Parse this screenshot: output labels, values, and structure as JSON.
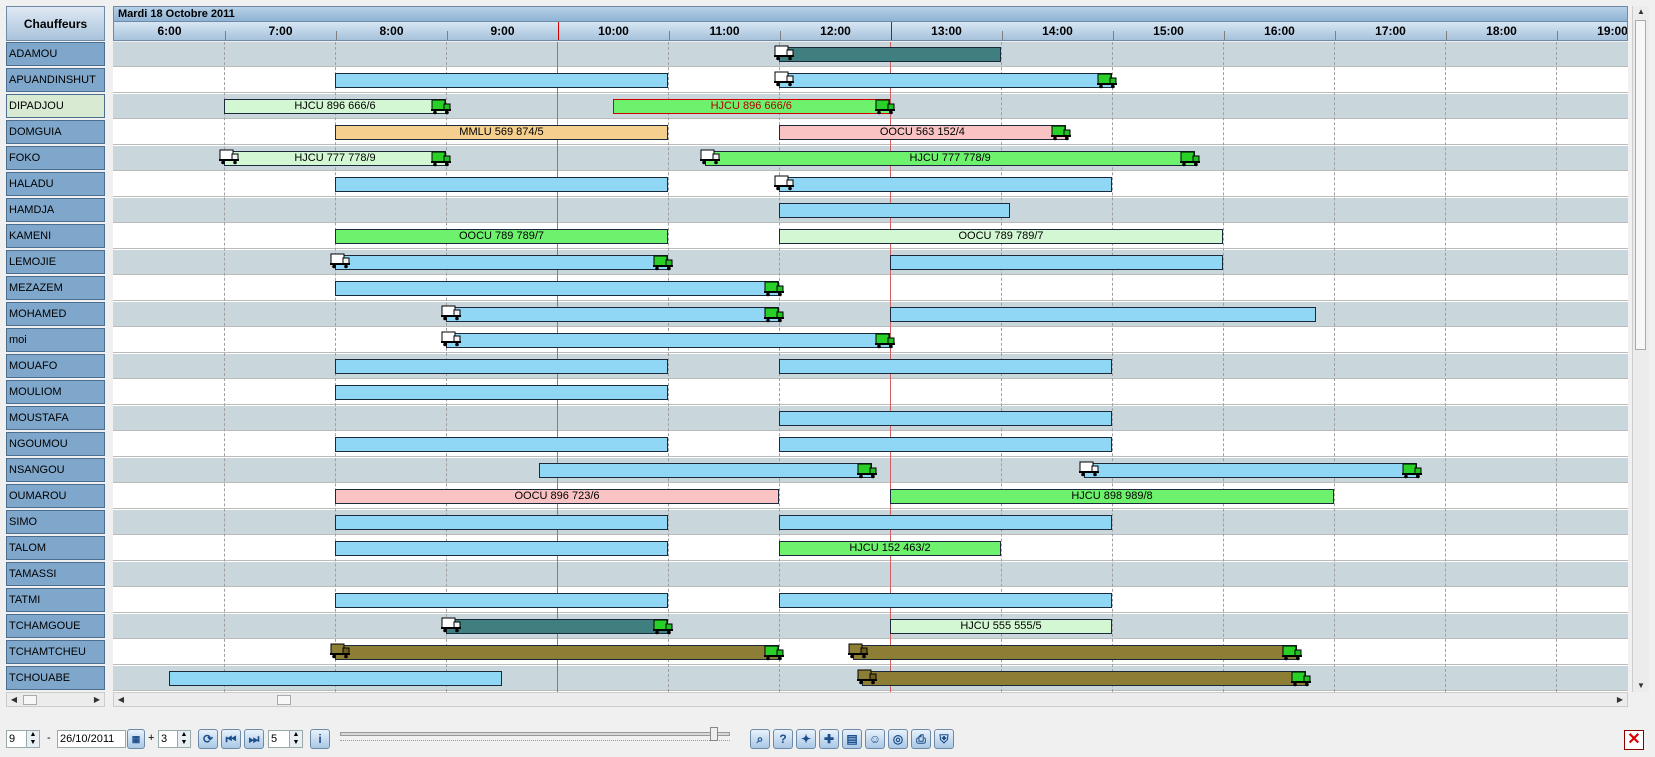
{
  "header": {
    "drivers_label": "Chauffeurs",
    "date_label": "Mardi 18 Octobre 2011",
    "hours": [
      "6:00",
      "7:00",
      "8:00",
      "9:00",
      "10:00",
      "11:00",
      "12:00",
      "13:00",
      "14:00",
      "15:00",
      "16:00",
      "17:00",
      "18:00",
      "19:00"
    ]
  },
  "drivers": [
    {
      "name": "ADAMOU"
    },
    {
      "name": "APUANDINSHUT"
    },
    {
      "name": "DIPADJOU"
    },
    {
      "name": "DOMGUIA"
    },
    {
      "name": "FOKO"
    },
    {
      "name": "HALADU"
    },
    {
      "name": "HAMDJA"
    },
    {
      "name": "KAMENI"
    },
    {
      "name": "LEMOJIE"
    },
    {
      "name": "MEZAZEM"
    },
    {
      "name": "MOHAMED"
    },
    {
      "name": "moi"
    },
    {
      "name": "MOUAFO"
    },
    {
      "name": "MOULIOM"
    },
    {
      "name": "MOUSTAFA"
    },
    {
      "name": "NGOUMOU"
    },
    {
      "name": "NSANGOU"
    },
    {
      "name": "OUMAROU"
    },
    {
      "name": "SIMO"
    },
    {
      "name": "TALOM"
    },
    {
      "name": "TAMASSI"
    },
    {
      "name": "TATMI"
    },
    {
      "name": "TCHAMGOUE"
    },
    {
      "name": "TCHAMTCHEU"
    },
    {
      "name": "TCHOUABE"
    }
  ],
  "tasks": [
    {
      "row": 0,
      "start": "11:30",
      "end": "13:30",
      "color": "teal",
      "label": "",
      "truck_start": "white"
    },
    {
      "row": 1,
      "start": "7:30",
      "end": "10:30",
      "color": "blue",
      "label": ""
    },
    {
      "row": 1,
      "start": "11:30",
      "end": "14:30",
      "color": "blue",
      "label": "",
      "truck_start": "white",
      "truck_end": "green"
    },
    {
      "row": 2,
      "start": "6:30",
      "end": "8:30",
      "color": "lgreen",
      "label": "HJCU 896 666/6",
      "truck_end": "green"
    },
    {
      "row": 2,
      "start": "10:00",
      "end": "12:30",
      "color": "green",
      "label": "HJCU 896 666/6",
      "truck_end": "green",
      "red_border": true
    },
    {
      "row": 3,
      "start": "7:30",
      "end": "10:30",
      "color": "orange",
      "label": "MMLU 569 874/5"
    },
    {
      "row": 3,
      "start": "11:30",
      "end": "14:05",
      "color": "pink",
      "label": "OOCU 563 152/4",
      "truck_end": "green"
    },
    {
      "row": 4,
      "start": "6:30",
      "end": "8:30",
      "color": "lgreen",
      "label": "HJCU 777 778/9",
      "truck_start": "white",
      "truck_end": "green"
    },
    {
      "row": 4,
      "start": "10:50",
      "end": "15:15",
      "color": "green",
      "label": "HJCU 777 778/9",
      "truck_start": "white",
      "truck_end": "green"
    },
    {
      "row": 5,
      "start": "7:30",
      "end": "10:30",
      "color": "blue",
      "label": ""
    },
    {
      "row": 5,
      "start": "11:30",
      "end": "14:30",
      "color": "blue",
      "label": "",
      "truck_start": "white"
    },
    {
      "row": 6,
      "start": "11:30",
      "end": "13:35",
      "color": "blue",
      "label": ""
    },
    {
      "row": 7,
      "start": "7:30",
      "end": "10:30",
      "color": "green",
      "label": "OOCU 789 789/7"
    },
    {
      "row": 7,
      "start": "11:30",
      "end": "15:30",
      "color": "lgreen",
      "label": "OOCU 789 789/7"
    },
    {
      "row": 8,
      "start": "7:30",
      "end": "10:30",
      "color": "blue",
      "label": "",
      "truck_start": "white",
      "truck_end": "green"
    },
    {
      "row": 8,
      "start": "12:30",
      "end": "15:30",
      "color": "blue",
      "label": ""
    },
    {
      "row": 9,
      "start": "7:30",
      "end": "11:30",
      "color": "blue",
      "label": "",
      "truck_end": "green"
    },
    {
      "row": 10,
      "start": "8:30",
      "end": "11:30",
      "color": "blue",
      "label": "",
      "truck_start": "white",
      "truck_end": "green"
    },
    {
      "row": 10,
      "start": "12:30",
      "end": "16:20",
      "color": "blue",
      "label": ""
    },
    {
      "row": 11,
      "start": "8:30",
      "end": "12:30",
      "color": "blue",
      "label": "",
      "truck_start": "white",
      "truck_end": "green"
    },
    {
      "row": 12,
      "start": "7:30",
      "end": "10:30",
      "color": "blue",
      "label": ""
    },
    {
      "row": 12,
      "start": "11:30",
      "end": "14:30",
      "color": "blue",
      "label": ""
    },
    {
      "row": 13,
      "start": "7:30",
      "end": "10:30",
      "color": "blue",
      "label": ""
    },
    {
      "row": 14,
      "start": "11:30",
      "end": "14:30",
      "color": "blue",
      "label": ""
    },
    {
      "row": 15,
      "start": "7:30",
      "end": "10:30",
      "color": "blue",
      "label": ""
    },
    {
      "row": 15,
      "start": "11:30",
      "end": "14:30",
      "color": "blue",
      "label": ""
    },
    {
      "row": 16,
      "start": "9:20",
      "end": "12:20",
      "color": "blue",
      "label": "",
      "truck_end": "green"
    },
    {
      "row": 16,
      "start": "14:15",
      "end": "17:15",
      "color": "blue",
      "label": "",
      "truck_start": "white",
      "truck_end": "green"
    },
    {
      "row": 17,
      "start": "7:30",
      "end": "11:30",
      "color": "pink",
      "label": "OOCU 896 723/6"
    },
    {
      "row": 17,
      "start": "12:30",
      "end": "16:30",
      "color": "green",
      "label": "HJCU 898 989/8"
    },
    {
      "row": 18,
      "start": "7:30",
      "end": "10:30",
      "color": "blue",
      "label": ""
    },
    {
      "row": 18,
      "start": "11:30",
      "end": "14:30",
      "color": "blue",
      "label": ""
    },
    {
      "row": 19,
      "start": "7:30",
      "end": "10:30",
      "color": "blue",
      "label": ""
    },
    {
      "row": 19,
      "start": "11:30",
      "end": "13:30",
      "color": "green",
      "label": "HJCU 152 463/2"
    },
    {
      "row": 21,
      "start": "7:30",
      "end": "10:30",
      "color": "blue",
      "label": ""
    },
    {
      "row": 21,
      "start": "11:30",
      "end": "14:30",
      "color": "blue",
      "label": ""
    },
    {
      "row": 22,
      "start": "8:30",
      "end": "10:30",
      "color": "teal",
      "label": "",
      "truck_start": "white",
      "truck_end": "green"
    },
    {
      "row": 22,
      "start": "12:30",
      "end": "14:30",
      "color": "lgreen",
      "label": "HJCU 555 555/5"
    },
    {
      "row": 23,
      "start": "7:30",
      "end": "11:30",
      "color": "olive",
      "label": "",
      "truck_start": "olive",
      "truck_end": "green"
    },
    {
      "row": 23,
      "start": "12:10",
      "end": "16:10",
      "color": "olive",
      "label": "",
      "truck_start": "olive",
      "truck_end": "green"
    },
    {
      "row": 24,
      "start": "6:00",
      "end": "9:00",
      "color": "blue",
      "label": ""
    },
    {
      "row": 24,
      "start": "12:15",
      "end": "16:15",
      "color": "olive",
      "label": "",
      "truck_start": "olive",
      "truck_end": "green"
    }
  ],
  "colors": {
    "blue": "#8fd7f5",
    "teal": "#3f7f7f",
    "lgreen": "#d3f7d3",
    "green": "#6ef26e",
    "orange": "#f5cf8d",
    "pink": "#f9c3c3",
    "olive": "#8c7e35"
  },
  "toolbar": {
    "rows_value": "9",
    "dash": "-",
    "date_value": "26/10/2011",
    "plus": "+",
    "days_value": "3",
    "step_value": "5",
    "icons": [
      "refresh-icon",
      "first-icon",
      "last-icon",
      "info-icon",
      "search-icon",
      "help-icon",
      "lamp-icon",
      "add-icon",
      "calendar-icon",
      "person-icon",
      "target-icon",
      "print-icon",
      "shield-icon",
      "close-icon"
    ]
  }
}
